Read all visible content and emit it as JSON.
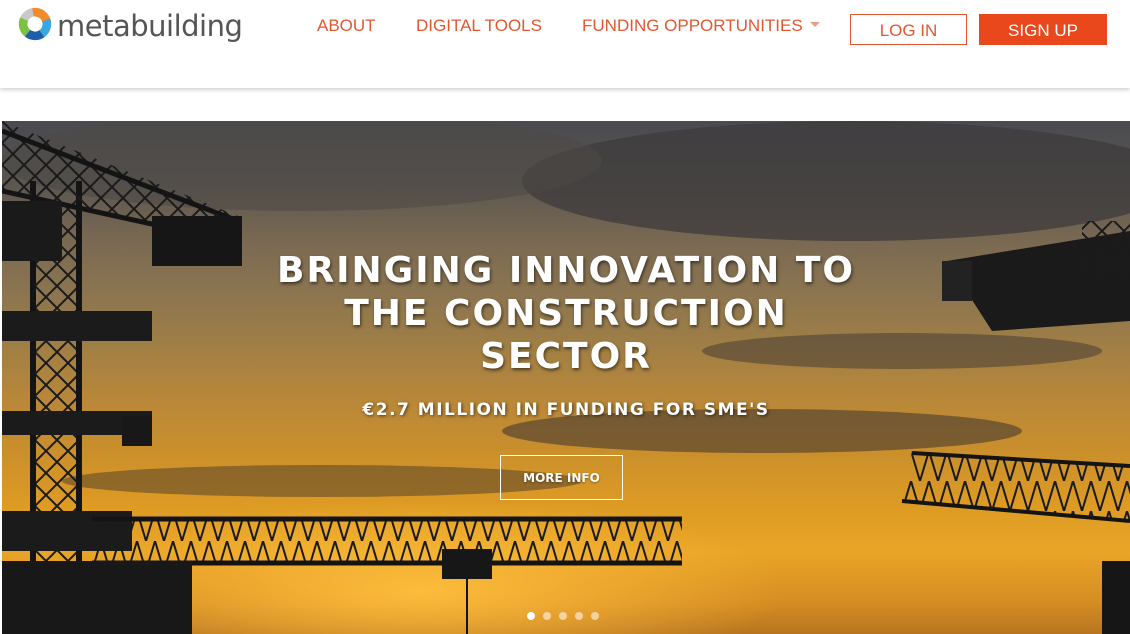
{
  "header": {
    "logo_text": "metabuilding",
    "nav": {
      "about": "ABOUT",
      "digital_tools": "DIGITAL TOOLS",
      "funding_opportunities": "FUNDING OPPORTUNITIES"
    },
    "login_label": "LOG IN",
    "signup_label": "SIGN UP"
  },
  "hero": {
    "title": "BRINGING INNOVATION TO THE CONSTRUCTION SECTOR",
    "subtitle": "€2.7 MILLION IN FUNDING FOR SME'S",
    "cta_label": "MORE INFO",
    "slides": {
      "count": 5,
      "active": 1
    }
  },
  "colors": {
    "accent": "#e4572e",
    "signup_bg": "#e8481c",
    "logo_text": "#555555",
    "logo_segments": [
      "#f28c28",
      "#3aa7e0",
      "#1f5fa8",
      "#7cc242",
      "#c9c9c9"
    ]
  },
  "icons": {
    "logo": "metabuilding-ring-logo-icon",
    "dropdown": "caret-down-icon"
  }
}
